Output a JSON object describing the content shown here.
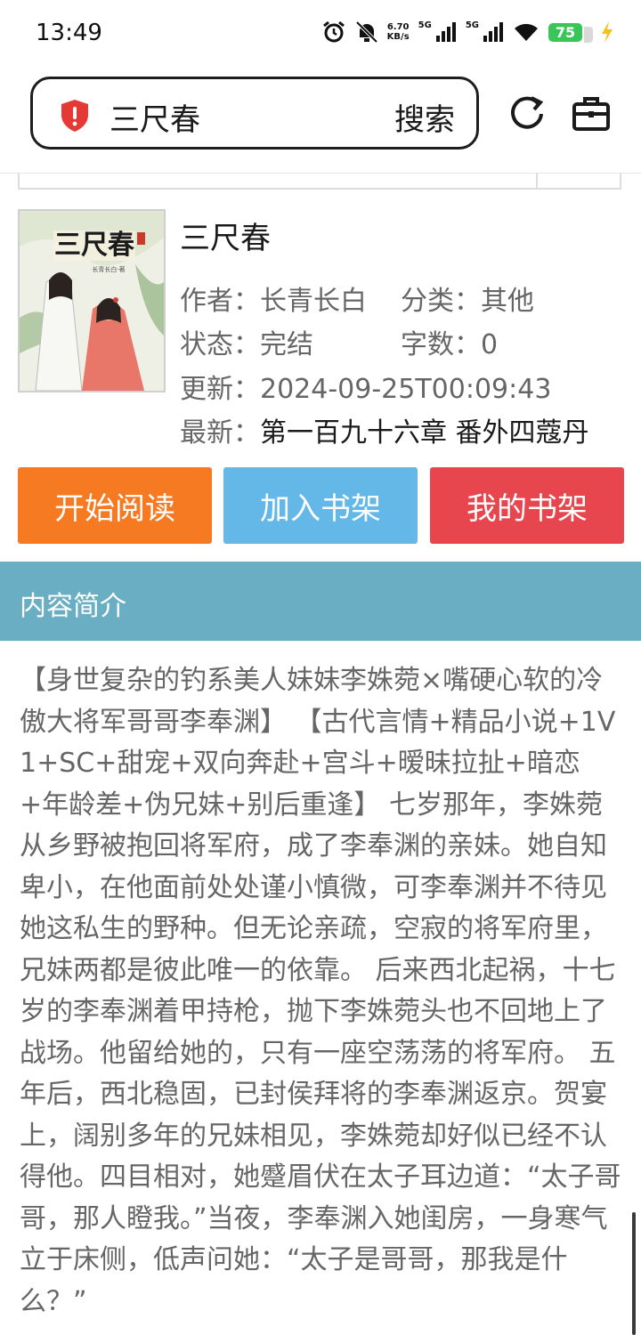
{
  "status_bar": {
    "time": "13:49",
    "net_speed_value": "6.70",
    "net_speed_unit": "KB/s",
    "signal1_label": "5G",
    "signal2_label": "5G",
    "battery_level": "75"
  },
  "search": {
    "query": "三尺春",
    "button_label": "搜索"
  },
  "book": {
    "title": "三尺春",
    "author_label": "作者：",
    "author": "长青长白",
    "category_label": "分类：",
    "category": "其他",
    "status_label": "状态：",
    "status": "完结",
    "word_count_label": "字数：",
    "word_count": "0",
    "updated_label": "更新：",
    "updated": "2024-09-25T00:09:43",
    "latest_label": "最新：",
    "latest_chapter": "第一百九十六章 番外四蔻丹"
  },
  "cover": {
    "title_text": "三尺春",
    "author_text": "长青长白·著"
  },
  "actions": {
    "read": "开始阅读",
    "add_shelf": "加入书架",
    "my_shelf": "我的书架"
  },
  "intro": {
    "header": "内容简介",
    "text": "【身世复杂的钓系美人妹妹李姝菀×嘴硬心软的冷傲大将军哥哥李奉渊】 【古代言情+精品小说+1V1+SC+甜宠+双向奔赴+宫斗+暧昧拉扯+暗恋+年龄差+伪兄妹+别后重逢】 七岁那年，李姝菀从乡野被抱回将军府，成了李奉渊的亲妹。她自知卑小，在他面前处处谨小慎微，可李奉渊并不待见她这私生的野种。但无论亲疏，空寂的将军府里，兄妹两都是彼此唯一的依靠。 后来西北起祸，十七岁的李奉渊着甲持枪，抛下李姝菀头也不回地上了战场。他留给她的，只有一座空荡荡的将军府。 五年后，西北稳固，已封侯拜将的李奉渊返京。贺宴上，阔别多年的兄妹相见，李姝菀却好似已经不认得他。四目相对，她蹙眉伏在太子耳边道：“太子哥哥，那人瞪我。”当夜，李奉渊入她闺房，一身寒气立于床侧，低声问她：“太子是哥哥，那我是什么？”"
  },
  "colors": {
    "read_button": "#f57a22",
    "add_button": "#64b8e8",
    "shelf_button": "#e8464f",
    "intro_header": "#6aaec4",
    "shield": "#e53935",
    "battery": "#39c55a"
  }
}
